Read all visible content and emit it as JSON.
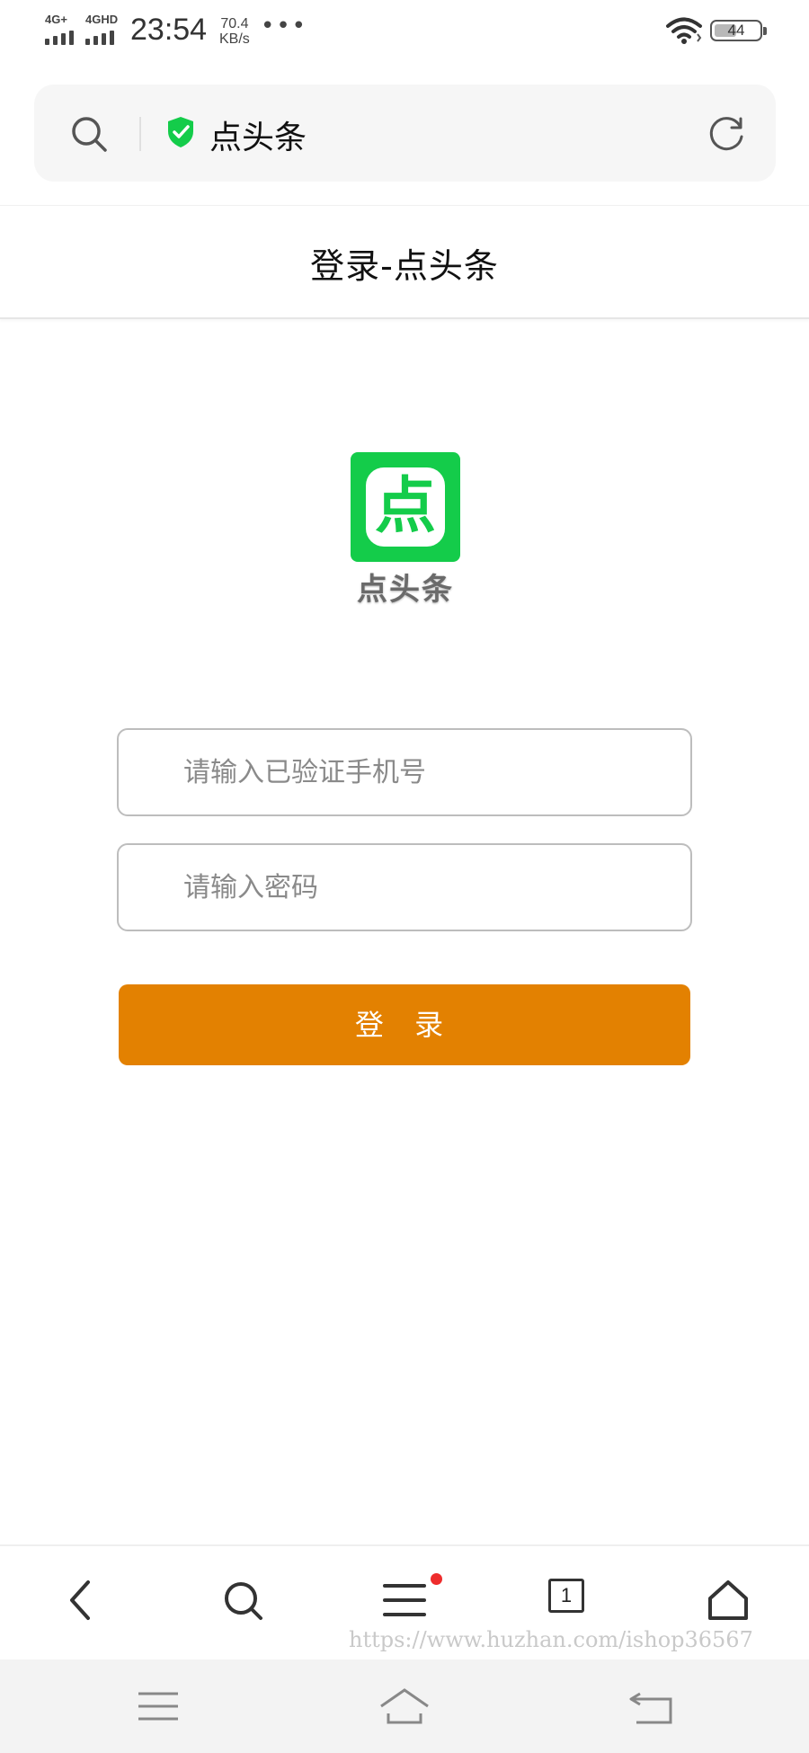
{
  "status_bar": {
    "network_1": "4G+",
    "network_2": "4GHD",
    "time": "23:54",
    "speed_value": "70.4",
    "speed_unit": "KB/s",
    "more": "•••",
    "battery": "44"
  },
  "address_bar": {
    "site_name": "点头条",
    "search_icon": "search-icon",
    "secure_icon": "shield-check-icon",
    "refresh_icon": "refresh-icon",
    "secure_color": "#14cc4a"
  },
  "page": {
    "title": "登录-点头条"
  },
  "logo": {
    "char": "点",
    "name": "点头条",
    "color": "#14cc4a"
  },
  "form": {
    "phone_placeholder": "请输入已验证手机号",
    "phone_value": "",
    "password_placeholder": "请输入密码",
    "password_value": "",
    "login_label": "登 录",
    "login_color": "#e38101"
  },
  "toolbar": {
    "back_icon": "chevron-left-icon",
    "search_icon": "search-icon",
    "menu_icon": "menu-icon",
    "tabs_count": "1",
    "home_icon": "home-icon"
  },
  "watermark": "https://www.huzhan.com/ishop36567",
  "system_nav": {
    "menu_icon": "menu-icon",
    "home_icon": "home-icon",
    "back_icon": "back-icon"
  }
}
